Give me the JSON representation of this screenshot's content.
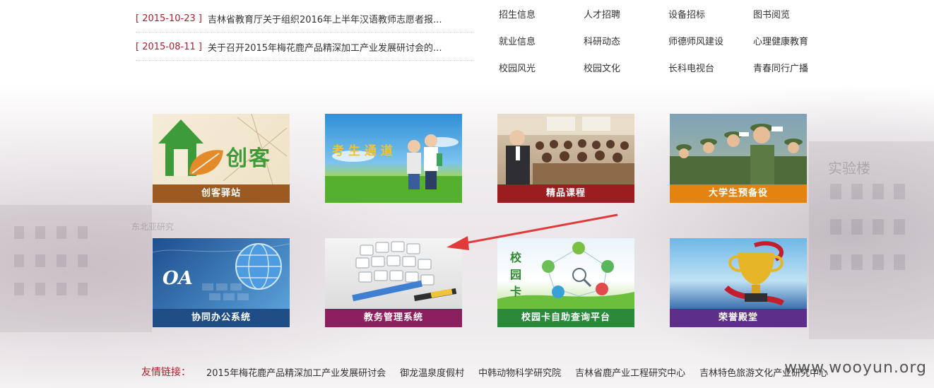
{
  "news": [
    {
      "date": "[ 2015-10-23 ]",
      "title": "吉林省教育厅关于组织2016年上半年汉语教师志愿者报..."
    },
    {
      "date": "[ 2015-08-11 ]",
      "title": "关于召开2015年梅花鹿产品精深加工产业发展研讨会的..."
    }
  ],
  "quick_links": [
    "招生信息",
    "人才招聘",
    "设备招标",
    "图书阅览",
    "就业信息",
    "科研动态",
    "师德师风建设",
    "心理健康教育",
    "校园风光",
    "校园文化",
    "长科电视台",
    "青春同行广播"
  ],
  "tiles": [
    {
      "label": "创客驿站",
      "art_text": "创客",
      "bar_color": "#9a5a22"
    },
    {
      "label": "",
      "art_text": "考 生 通 道",
      "bar_color": ""
    },
    {
      "label": "精品课程",
      "art_text": "",
      "bar_color": "#9c1d1f"
    },
    {
      "label": "大学生预备役",
      "art_text": "",
      "bar_color": "#e2840f"
    },
    {
      "label": "协同办公系统",
      "art_text": "OA",
      "bar_color": "#1f4e86"
    },
    {
      "label": "教务管理系统",
      "art_text": "",
      "bar_color": "#8c1f5e"
    },
    {
      "label": "校园卡自助查询平台",
      "art_text": "校园卡",
      "bar_color": "#2a8a3a"
    },
    {
      "label": "荣誉殿堂",
      "art_text": "",
      "bar_color": "#5d2e8a"
    }
  ],
  "friend_links": {
    "label": "友情链接：",
    "items": [
      "2015年梅花鹿产品精深加工产业发展研讨会",
      "御龙温泉度假村",
      "中韩动物科学研究院",
      "吉林省鹿产业工程研究中心",
      "吉林特色旅游文化产业研究中心"
    ]
  },
  "watermark": "www.wooyun.org",
  "background_text": [
    "实验楼",
    "东北亚研究"
  ],
  "colors": {
    "accent": "#a3232b",
    "arrow": "#e23a3a"
  }
}
